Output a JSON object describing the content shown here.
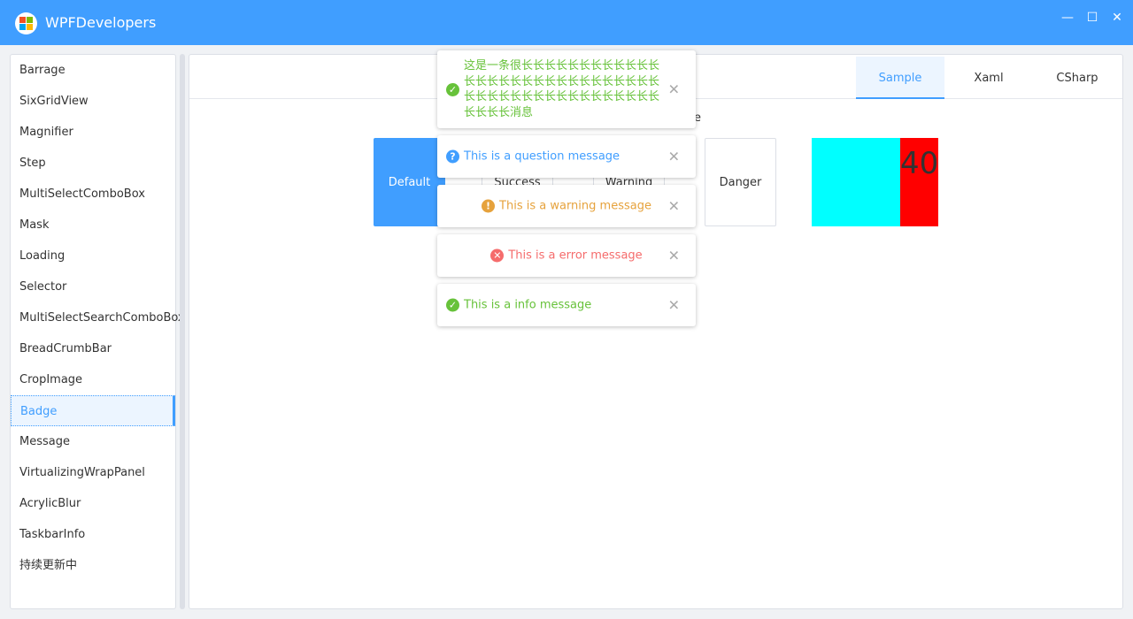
{
  "window": {
    "title": "WPFDevelopers",
    "minimize": "—",
    "maximize": "☐",
    "close": "✕"
  },
  "sidebar": {
    "items": [
      "Barrage",
      "SixGridView",
      "Magnifier",
      "Step",
      "MultiSelectComboBox",
      "Mask",
      "Loading",
      "Selector",
      "MultiSelectSearchComboBox",
      "BreadCrumbBar",
      "CropImage",
      "Badge",
      "Message",
      "VirtualizingWrapPanel",
      "AcrylicBlur",
      "TaskbarInfo",
      "持续更新中"
    ],
    "active": "Badge"
  },
  "tabs": [
    "Sample",
    "Xaml",
    "CSharp"
  ],
  "buttons": {
    "default": "Default",
    "success": "Success",
    "warning": "Warning",
    "danger": "Danger",
    "partial_heading": "e"
  },
  "badge": {
    "value": "40",
    "box_color": "#00ffff",
    "badge_color": "#ff0000"
  },
  "messages": [
    {
      "type": "success",
      "icon": "check-circle-icon",
      "color": "#67c23a",
      "text": "这是一条很长长长长长长长长长长长长长长长长长长长长长长长长长长长长长长长长长长长长长长长长长长长长长长长长长长消息"
    },
    {
      "type": "question",
      "icon": "question-circle-icon",
      "color": "#409eff",
      "text": "This is a question message"
    },
    {
      "type": "warning",
      "icon": "exclamation-circle-icon",
      "color": "#e6a23c",
      "text": "This is a warning message"
    },
    {
      "type": "error",
      "icon": "x-circle-icon",
      "color": "#f56c6c",
      "text": "This is a error message"
    },
    {
      "type": "info",
      "icon": "check-circle-icon",
      "color": "#67c23a",
      "text": "This is a info message"
    }
  ],
  "accent": "#409eff"
}
